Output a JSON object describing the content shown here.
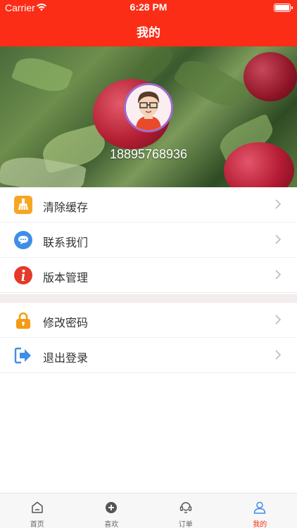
{
  "status_bar": {
    "carrier": "Carrier",
    "time": "6:28 PM"
  },
  "nav": {
    "title": "我的"
  },
  "profile": {
    "phone": "18895768936"
  },
  "menu_group_1": [
    {
      "label": "清除缓存",
      "icon": "broom-icon",
      "color": "#f5a623"
    },
    {
      "label": "联系我们",
      "icon": "chat-bubble-icon",
      "color": "#3e8ee8"
    },
    {
      "label": "版本管理",
      "icon": "info-icon",
      "color": "#e33a2a"
    }
  ],
  "menu_group_2": [
    {
      "label": "修改密码",
      "icon": "lock-icon",
      "color": "#f59a12"
    },
    {
      "label": "退出登录",
      "icon": "logout-icon",
      "color": "#3e8ee8"
    }
  ],
  "tabs": [
    {
      "label": "首页",
      "icon": "home-icon"
    },
    {
      "label": "喜欢",
      "icon": "plus-circle-icon"
    },
    {
      "label": "订单",
      "icon": "orders-icon"
    },
    {
      "label": "我的",
      "icon": "user-icon",
      "active": true
    }
  ],
  "colors": {
    "primary": "#fb2d16",
    "active_tab": "#fb2d16"
  }
}
